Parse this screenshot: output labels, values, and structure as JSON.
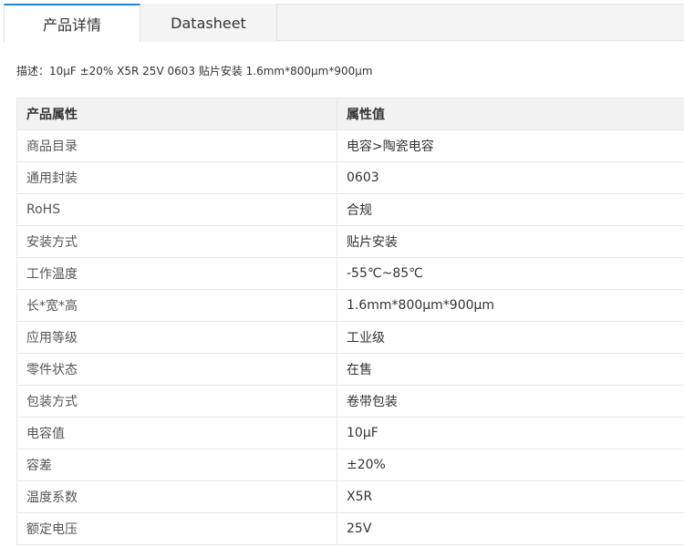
{
  "tabs": [
    {
      "label": "产品详情",
      "active": true
    },
    {
      "label": "Datasheet",
      "active": false
    }
  ],
  "description": "描述：10μF ±20% X5R 25V 0603 贴片安装 1.6mm*800μm*900μm",
  "table": {
    "headers": [
      "产品属性",
      "属性值"
    ],
    "rows": [
      {
        "key": "商品目录",
        "value": "电容>陶瓷电容"
      },
      {
        "key": "通用封装",
        "value": "0603"
      },
      {
        "key": "RoHS",
        "value": "合规"
      },
      {
        "key": "安装方式",
        "value": "贴片安装"
      },
      {
        "key": "工作温度",
        "value": "-55℃~85℃"
      },
      {
        "key": "长*宽*高",
        "value": "1.6mm*800μm*900μm"
      },
      {
        "key": "应用等级",
        "value": "工业级"
      },
      {
        "key": "零件状态",
        "value": "在售"
      },
      {
        "key": "包装方式",
        "value": "卷带包装"
      },
      {
        "key": "电容值",
        "value": "10μF"
      },
      {
        "key": "容差",
        "value": "±20%"
      },
      {
        "key": "温度系数",
        "value": "X5R"
      },
      {
        "key": "额定电压",
        "value": "25V"
      }
    ]
  },
  "colors": {
    "accent": "#1a84d6",
    "header_bg": "#f2f2f2",
    "border": "#e6e6e6"
  }
}
